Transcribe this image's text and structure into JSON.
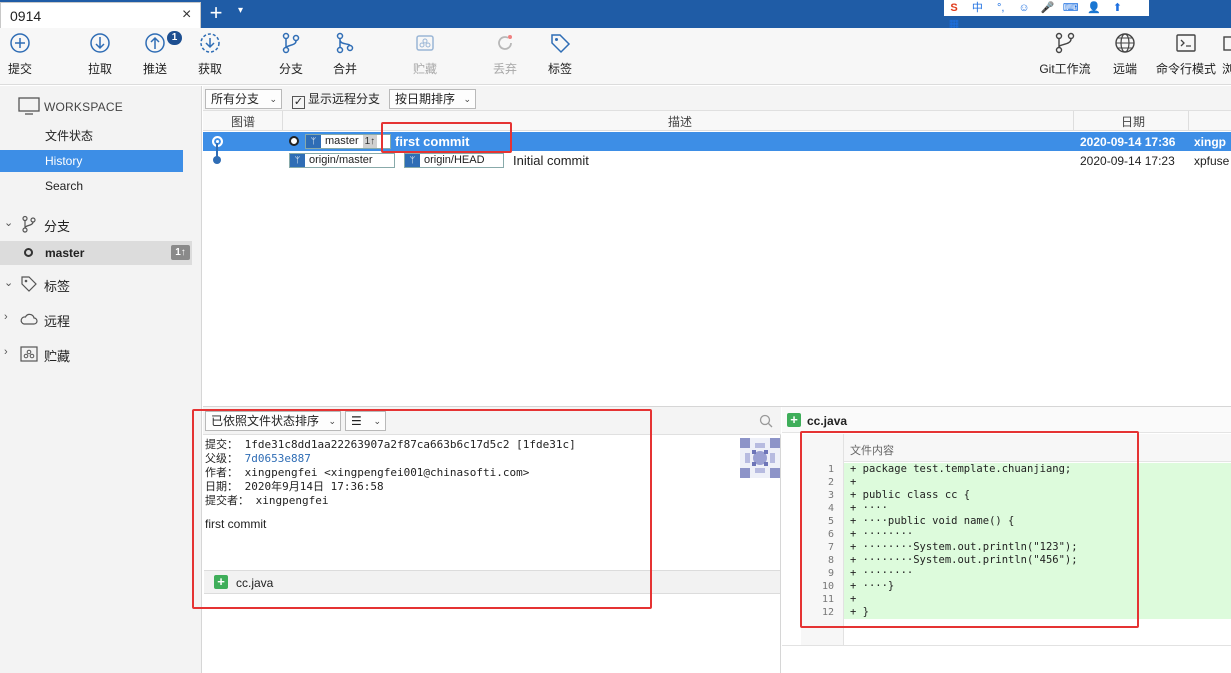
{
  "window": {
    "tab_title": "0914",
    "tab_close": "×",
    "tab_add": "+",
    "tab_menu": "▾"
  },
  "toolbar": {
    "commit": "提交",
    "pull": "拉取",
    "push": "推送",
    "push_badge": "1",
    "fetch": "获取",
    "branch": "分支",
    "merge": "合并",
    "stash": "贮藏",
    "discard": "丢弃",
    "tag": "标签",
    "gitflow": "Git工作流",
    "remote": "远端",
    "terminal": "命令行模式",
    "explorer": "浏"
  },
  "sidebar": {
    "workspace": "WORKSPACE",
    "items": [
      {
        "label": "文件状态"
      },
      {
        "label": "History"
      },
      {
        "label": "Search"
      }
    ],
    "sections": {
      "branches": "分支",
      "tags": "标签",
      "remotes": "远程",
      "stashes": "贮藏"
    },
    "current_branch": {
      "label": "master",
      "count": "1↑"
    }
  },
  "filterbar": {
    "branches": "所有分支",
    "show_remote": "显示远程分支",
    "show_remote_checked": "✓",
    "sort": "按日期排序"
  },
  "columns": {
    "graph": "图谱",
    "description": "描述",
    "date": "日期"
  },
  "commits": [
    {
      "refs": [
        {
          "name": "master",
          "count": "1↑"
        }
      ],
      "message": "first commit",
      "date": "2020-09-14 17:36",
      "author": "xingp"
    },
    {
      "refs": [
        {
          "name": "origin/master"
        },
        {
          "name": "origin/HEAD"
        }
      ],
      "message": "Initial commit",
      "date": "2020-09-14 17:23",
      "author": "xpfuse"
    }
  ],
  "detail": {
    "sort_mode": "已依照文件状态排序",
    "list_mode_icon": "☰",
    "commit_label": "提交：",
    "commit_hash": "1fde31c8dd1aa22263907a2f87ca663b6c17d5c2 [1fde31c]",
    "parent_label": "父级：",
    "parent_hash": "7d0653e887",
    "author_label": "作者：",
    "author_value": "xingpengfei <xingpengfei001@chinasofti.com>",
    "date_label": "日期：",
    "date_value": "2020年9月14日 17:36:58",
    "committer_label": "提交者：",
    "committer_value": "xingpengfei",
    "message": "first commit",
    "files": [
      {
        "name": "cc.java"
      }
    ]
  },
  "diff": {
    "file": "cc.java",
    "hunk_header": "文件内容",
    "lines": [
      {
        "n": "1",
        "code": "+ package test.template.chuanjiang;"
      },
      {
        "n": "2",
        "code": "+ "
      },
      {
        "n": "3",
        "code": "+ public class cc {"
      },
      {
        "n": "4",
        "code": "+ ····"
      },
      {
        "n": "5",
        "code": "+ ····public void name() {"
      },
      {
        "n": "6",
        "code": "+ ········"
      },
      {
        "n": "7",
        "code": "+ ········System.out.println(\"123\");"
      },
      {
        "n": "8",
        "code": "+ ········System.out.println(\"456\");"
      },
      {
        "n": "9",
        "code": "+ ········"
      },
      {
        "n": "10",
        "code": "+ ····}"
      },
      {
        "n": "11",
        "code": "+ "
      },
      {
        "n": "12",
        "code": "+ }"
      }
    ]
  },
  "ime": {
    "logo": "S",
    "items": [
      "中",
      "°,",
      "☺",
      "🎤",
      "⌨",
      "👤",
      "⬆",
      "▦"
    ]
  },
  "colors": {
    "accent": "#3d8ee6",
    "tabbar": "#1f5ca6",
    "added": "#ddfbdc",
    "annotation": "#e53333"
  }
}
